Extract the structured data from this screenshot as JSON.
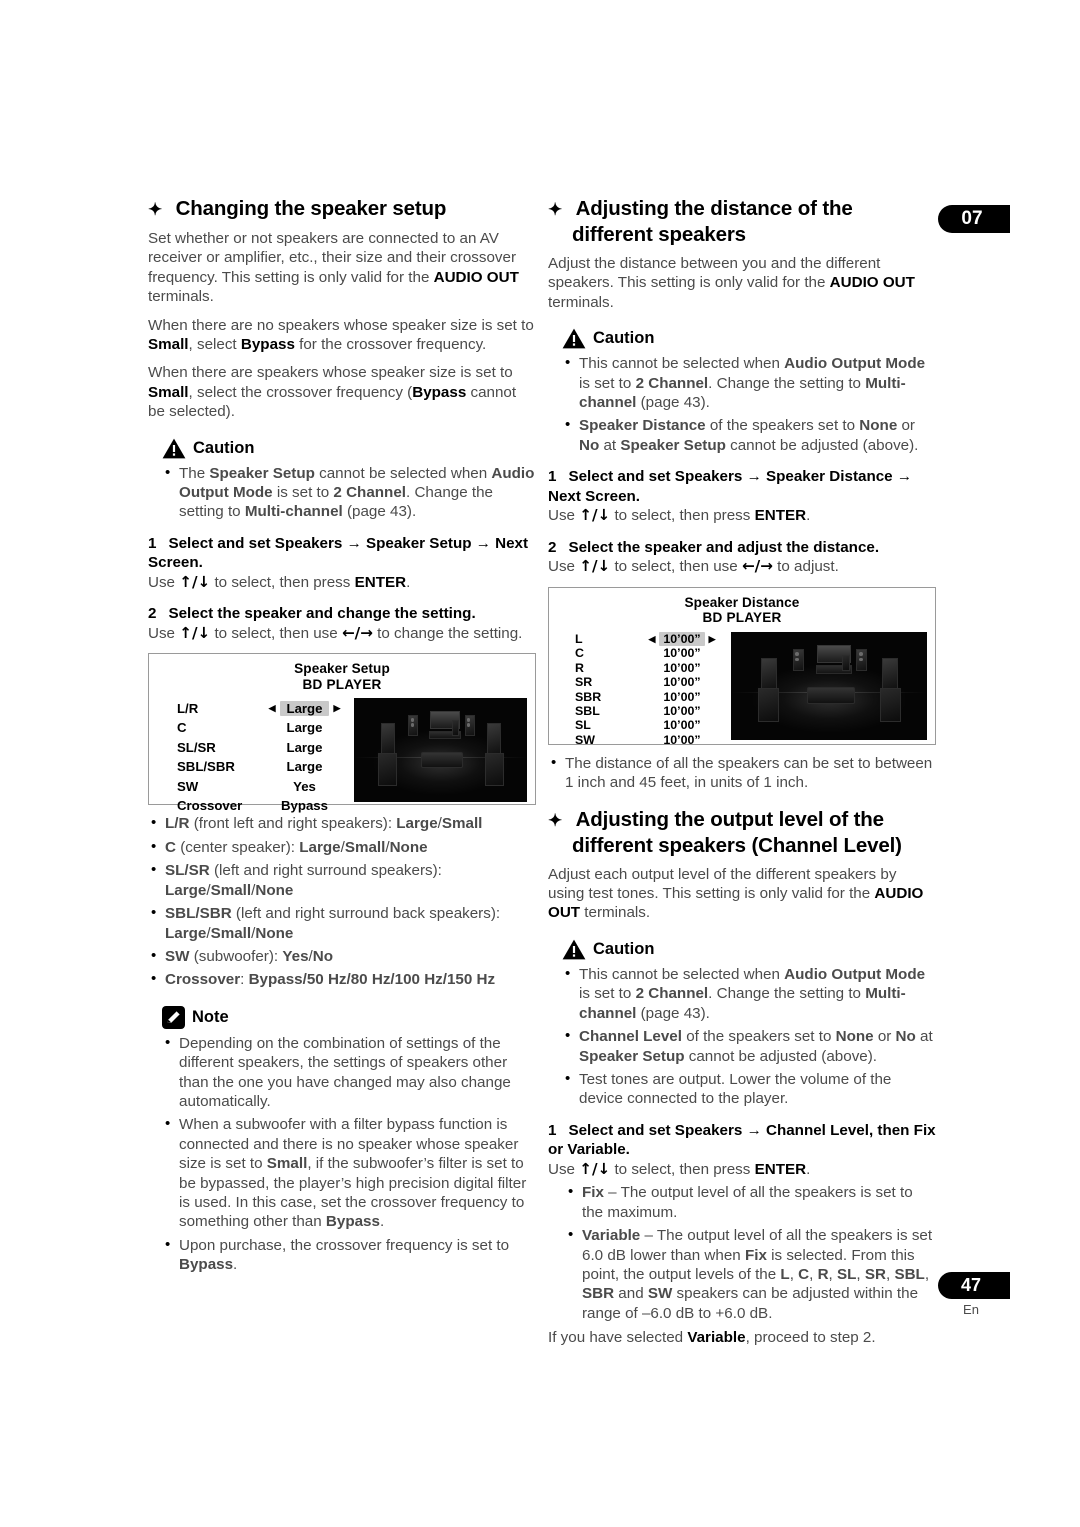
{
  "page": {
    "chapter_tab": "07",
    "page_number": "47",
    "language_code": "En"
  },
  "left_column": {
    "heading": "Changing the speaker setup",
    "intro_1_a": "Set whether or not speakers are connected to an AV receiver or amplifier, etc., their size and their crossover frequency. This setting is only valid for the ",
    "intro_1_b": "AUDIO OUT",
    "intro_1_c": " terminals.",
    "intro_2_a": "When there are no speakers whose speaker size is set to ",
    "intro_2_b": "Small",
    "intro_2_c": ", select ",
    "intro_2_d": "Bypass",
    "intro_2_e": " for the crossover frequency.",
    "intro_3_a": "When there are speakers whose speaker size is set to ",
    "intro_3_b": "Small",
    "intro_3_c": ", select the crossover frequency (",
    "intro_3_d": "Bypass",
    "intro_3_e": " cannot be selected).",
    "caution": {
      "label": "Caution",
      "items": [
        {
          "p1": "The ",
          "b1": "Speaker Setup",
          "p2": " cannot be selected when ",
          "b2": "Audio Output Mode",
          "p3": " is set to ",
          "b3": "2 Channel",
          "p4": ". Change the setting to ",
          "b4": "Multi-channel",
          "p5": " (page 43)."
        }
      ]
    },
    "step1": {
      "num": "1",
      "title": "Select and set Speakers → Speaker Setup → Next Screen.",
      "detail_a": "Use ",
      "detail_arrows": "↑/↓",
      "detail_b": " to select, then press ",
      "detail_bold": "ENTER",
      "detail_c": "."
    },
    "step2": {
      "num": "2",
      "title": "Select the speaker and change the setting.",
      "detail_a": "Use ",
      "detail_arrows": "↑/↓",
      "detail_b": " to select, then use ",
      "detail_arrows2": "←/→",
      "detail_c": " to change the setting."
    },
    "osd": {
      "title": "Speaker Setup",
      "subtitle": "BD PLAYER",
      "rows": [
        {
          "label": "L/R",
          "value": "Large",
          "selected": true
        },
        {
          "label": "C",
          "value": "Large",
          "selected": false
        },
        {
          "label": "SL/SR",
          "value": "Large",
          "selected": false
        },
        {
          "label": "SBL/SBR",
          "value": "Large",
          "selected": false
        },
        {
          "label": "SW",
          "value": "Yes",
          "selected": false
        },
        {
          "label": "Crossover",
          "value": "Bypass",
          "selected": false
        }
      ]
    },
    "options": [
      {
        "b1": "L/R",
        "p1": " (front left and right speakers): ",
        "b2": "Large",
        "sep1": "/",
        "b3": "Small"
      },
      {
        "b1": "C",
        "p1": " (center speaker): ",
        "b2": "Large",
        "sep1": "/",
        "b3": "Small",
        "sep2": "/",
        "b4": "None"
      },
      {
        "b1": "SL/SR",
        "p1": " (left and right surround speakers): ",
        "b2": "Large",
        "sep1": "/",
        "b3": "Small",
        "sep2": "/",
        "b4": "None"
      },
      {
        "b1": "SBL/SBR",
        "p1": " (left and right surround back speakers): ",
        "b2": "Large",
        "sep1": "/",
        "b3": "Small",
        "sep2": "/",
        "b4": "None"
      },
      {
        "b1": "SW",
        "p1": " (subwoofer): ",
        "b2": "Yes",
        "sep1": "/",
        "b3": "No"
      },
      {
        "b1": "Crossover",
        "p1": ": ",
        "b2": "Bypass/50 Hz/80 Hz/100 Hz/150 Hz"
      }
    ],
    "note": {
      "label": "Note",
      "item1": "Depending on the combination of settings of the different speakers, the settings of speakers other than the one you have changed may also change automatically.",
      "item2_a": "When a subwoofer with a filter bypass function is connected and there is no speaker whose speaker size is set to ",
      "item2_b": "Small",
      "item2_c": ", if the subwoofer’s filter is set to be bypassed, the player’s high precision digital filter is used. In this case, set the crossover frequency to something other than ",
      "item2_d": "Bypass",
      "item2_e": ".",
      "item3_a": "Upon purchase, the crossover frequency is set to ",
      "item3_b": "Bypass",
      "item3_c": "."
    }
  },
  "right_column": {
    "heading_1": "Adjusting the distance of the different speakers",
    "intro_a": "Adjust the distance between you and the different speakers. This setting is only valid for the ",
    "intro_b": "AUDIO OUT",
    "intro_c": " terminals.",
    "caution_1": {
      "label": "Caution",
      "item1": {
        "p1": "This cannot be selected when ",
        "b1": "Audio Output Mode",
        "p2": " is set to ",
        "b2": "2 Channel",
        "p3": ". Change the setting to ",
        "b3": "Multi-channel",
        "p4": " (page 43)."
      },
      "item2": {
        "b1": "Speaker Distance",
        "p1": " of the speakers set to ",
        "b2": "None",
        "p2": " or ",
        "b3": "No",
        "p3": " at ",
        "b4": "Speaker Setup",
        "p4": " cannot be adjusted (above)."
      }
    },
    "step1": {
      "num": "1",
      "title": "Select and set Speakers → Speaker Distance → Next Screen.",
      "detail_a": "Use ",
      "detail_arrows": "↑/↓",
      "detail_b": " to select, then press ",
      "detail_bold": "ENTER",
      "detail_c": "."
    },
    "step2": {
      "num": "2",
      "title": "Select the speaker and adjust the distance.",
      "detail_a": "Use ",
      "detail_arrows": "↑/↓",
      "detail_b": " to select, then use ",
      "detail_arrows2": "←/→",
      "detail_c": " to adjust."
    },
    "osd": {
      "title": "Speaker Distance",
      "subtitle": "BD PLAYER",
      "rows": [
        {
          "label": "L",
          "value": "10’00”",
          "selected": true
        },
        {
          "label": "C",
          "value": "10’00”",
          "selected": false
        },
        {
          "label": "R",
          "value": "10’00”",
          "selected": false
        },
        {
          "label": "SR",
          "value": "10’00”",
          "selected": false
        },
        {
          "label": "SBR",
          "value": "10’00”",
          "selected": false
        },
        {
          "label": "SBL",
          "value": "10’00”",
          "selected": false
        },
        {
          "label": "SL",
          "value": "10’00”",
          "selected": false
        },
        {
          "label": "SW",
          "value": "10’00”",
          "selected": false
        }
      ]
    },
    "distance_note": "The distance of all the speakers can be set to between 1 inch and 45 feet, in units of 1 inch.",
    "heading_2": "Adjusting the output level of the different speakers (Channel Level)",
    "intro2_a": "Adjust each output level of the different speakers by using test tones. This setting is only valid for the ",
    "intro2_b": "AUDIO OUT",
    "intro2_c": " terminals.",
    "caution_2": {
      "label": "Caution",
      "item1": {
        "p1": "This cannot be selected when ",
        "b1": "Audio Output Mode",
        "p2": " is set to ",
        "b2": "2 Channel",
        "p3": ". Change the setting to ",
        "b3": "Multi-channel",
        "p4": " (page 43)."
      },
      "item2": {
        "b1": "Channel Level",
        "p1": " of the speakers set to ",
        "b2": "None",
        "p2": " or ",
        "b3": "No",
        "p3": " at ",
        "b4": "Speaker Setup",
        "p4": " cannot be adjusted (above)."
      },
      "item3": "Test tones are output. Lower the volume of the device connected to the player."
    },
    "step1b": {
      "num": "1",
      "title": "Select and set Speakers → Channel Level, then Fix or Variable.",
      "detail_a": "Use ",
      "detail_arrows": "↑/↓",
      "detail_b": " to select, then press ",
      "detail_bold": "ENTER",
      "detail_c": "."
    },
    "fix_item": {
      "b1": "Fix",
      "p1": " – The output level of all the speakers is set to the maximum."
    },
    "variable_item": {
      "b1": "Variable",
      "p1": " – The output level of all the speakers is set 6.0 dB lower than when ",
      "b2": "Fix",
      "p2": " is selected. From this point, the output levels of the ",
      "b3": "L",
      "s1": ", ",
      "b4": "C",
      "s2": ", ",
      "b5": "R",
      "s3": ", ",
      "b6": "SL",
      "s4": ", ",
      "b7": "SR",
      "s5": ", ",
      "b8": "SBL",
      "s6": ", ",
      "b9": "SBR",
      "p3": " and ",
      "b10": "SW",
      "p4": " speakers can be adjusted within the range of –6.0 dB to +6.0 dB."
    },
    "closing_a": "If you have selected ",
    "closing_b": "Variable",
    "closing_c": ", proceed to step 2."
  }
}
